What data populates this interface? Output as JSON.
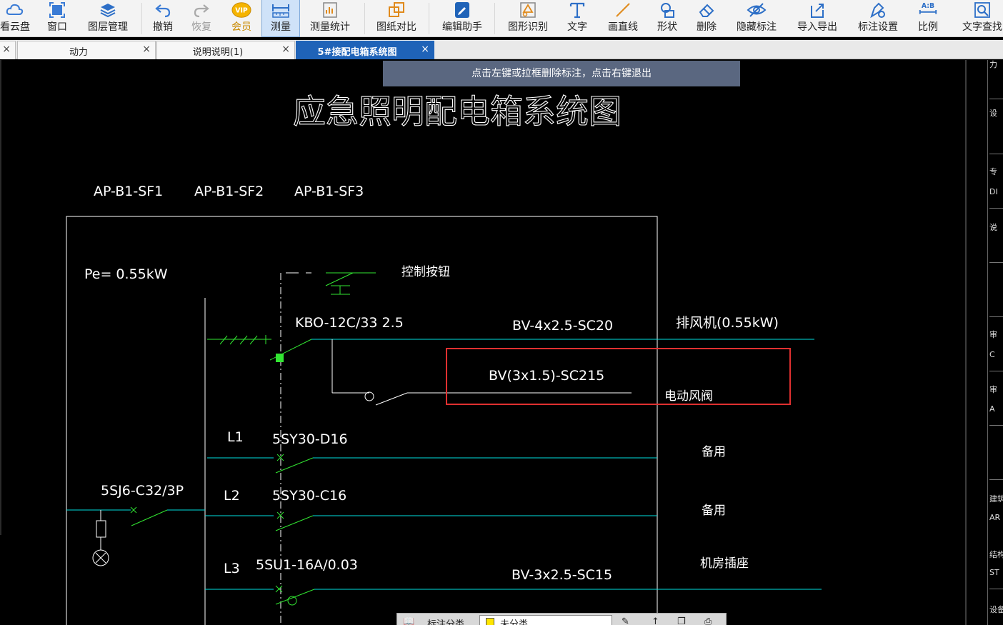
{
  "toolbar": {
    "items": [
      {
        "label": "看云盘",
        "icon": "cloud-icon"
      },
      {
        "label": "窗口",
        "icon": "window-icon"
      },
      {
        "label": "图层管理",
        "icon": "layers-icon"
      },
      {
        "label": "撤销",
        "icon": "undo-icon"
      },
      {
        "label": "恢复",
        "icon": "redo-icon"
      },
      {
        "label": "会员",
        "icon": "vip-icon"
      },
      {
        "label": "测量",
        "icon": "ruler-icon"
      },
      {
        "label": "测量统计",
        "icon": "measure-stats-icon"
      },
      {
        "label": "图纸对比",
        "icon": "compare-icon"
      },
      {
        "label": "编辑助手",
        "icon": "edit-assistant-icon"
      },
      {
        "label": "图形识别",
        "icon": "shape-recognize-icon"
      },
      {
        "label": "文字",
        "icon": "text-icon"
      },
      {
        "label": "画直线",
        "icon": "line-icon"
      },
      {
        "label": "形状",
        "icon": "shape-icon"
      },
      {
        "label": "删除",
        "icon": "eraser-icon"
      },
      {
        "label": "隐藏标注",
        "icon": "eye-hide-icon"
      },
      {
        "label": "导入导出",
        "icon": "import-export-icon"
      },
      {
        "label": "标注设置",
        "icon": "annotation-settings-icon"
      },
      {
        "label": "比例",
        "icon": "scale-icon"
      },
      {
        "label": "文字查找",
        "icon": "text-search-icon"
      }
    ],
    "vip_icon_text": "VIP",
    "scale_icon_text": "A:B"
  },
  "tabs": [
    {
      "label": "动力",
      "close": "×"
    },
    {
      "label": "说明说明(1)",
      "close": "×"
    },
    {
      "label": "5#接配电箱系统图",
      "close": "×"
    }
  ],
  "first_tab_close": "×",
  "tooltip": "点击左键或拉框删除标注，点击右键退出",
  "drawing": {
    "title": "应急照明配电箱系统图",
    "box_ids": [
      "AP-B1-SF1",
      "AP-B1-SF2",
      "AP-B1-SF3"
    ],
    "pe": "Pe= 0.55kW",
    "control_button": "控制按钮",
    "breaker_main": "KBO-12C/33  2.5",
    "cable_fan": "BV-4x2.5-SC20",
    "fan_label": "排风机(0.55kW)",
    "cable_damper": "BV(3x1.5)-SC215",
    "damper_label": "电动风阀",
    "l1": "L1",
    "l1_breaker": "5SY30-D16",
    "l1_label": "备用",
    "l2": "L2",
    "l2_breaker": "5SY30-C16",
    "l2_label": "备用",
    "l3": "L3",
    "l3_breaker": "5SU1-16A/0.03",
    "l3_cable": "BV-3x2.5-SC15",
    "l3_label": "机房插座",
    "incoming_breaker": "5SJ6-C32/3P"
  },
  "right_panel": {
    "items": [
      "力",
      "设",
      "专",
      "DI",
      "说",
      "审",
      "C",
      "审",
      "A",
      "建筑",
      "AR",
      "结构",
      "ST",
      "设备"
    ]
  },
  "bottom_bar": {
    "label": "标注分类",
    "value": "未分类"
  },
  "colors": {
    "toolbar_bg": "#f3f3f3",
    "active_tab": "#1f63b8",
    "tooltip_bg": "#5a6780",
    "cyan_wire": "#00e0e0",
    "green_symbol": "#32e632",
    "highlight_rect": "#e03030",
    "canvas_bg": "#000000"
  }
}
